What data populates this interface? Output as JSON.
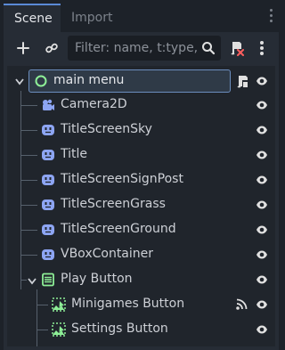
{
  "tabs": {
    "scene": "Scene",
    "import": "Import"
  },
  "toolbar": {
    "filter_placeholder": "Filter: name, t:type, g"
  },
  "icons": {
    "add": "plus-icon",
    "link": "link-icon",
    "search": "magnifier-icon",
    "script_remove": "script-remove-icon",
    "menu": "kebab-menu-icon",
    "visibility": "eye-icon",
    "script": "script-icon",
    "signal": "signal-icon"
  },
  "colors": {
    "accent": "#5b8ad6",
    "node2d_icon": "#8da5f3",
    "control_icon": "#8eef97",
    "text": "#cdd0d6"
  },
  "tree": {
    "root": "main menu",
    "items": [
      "Camera2D",
      "TitleScreenSky",
      "Title",
      "TitleScreenSignPost",
      "TitleScreenGrass",
      "TitleScreenGround",
      "VBoxContainer",
      "Play Button",
      "Minigames Button",
      "Settings Button"
    ]
  }
}
